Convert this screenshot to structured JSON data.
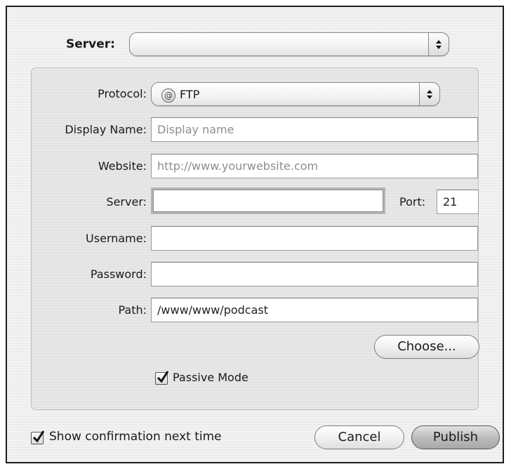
{
  "top": {
    "server_label": "Server:",
    "server_value": ""
  },
  "ftp": {
    "protocol_label": "Protocol:",
    "protocol_icon": "at-sign-icon",
    "protocol_icon_glyph": "@",
    "protocol_value": "FTP",
    "display_name_label": "Display Name:",
    "display_name_placeholder": "Display name",
    "website_label": "Website:",
    "website_placeholder": "http://www.yourwebsite.com",
    "server_label": "Server:",
    "server_value": "",
    "port_label": "Port:",
    "port_value": "21",
    "username_label": "Username:",
    "username_value": "",
    "password_label": "Password:",
    "password_value": "",
    "path_label": "Path:",
    "path_value": "/www/www/podcast",
    "choose_label": "Choose...",
    "passive_mode_label": "Passive Mode",
    "passive_mode_checked": true
  },
  "footer": {
    "show_confirmation_label": "Show confirmation next time",
    "show_confirmation_checked": true,
    "cancel_label": "Cancel",
    "publish_label": "Publish"
  }
}
